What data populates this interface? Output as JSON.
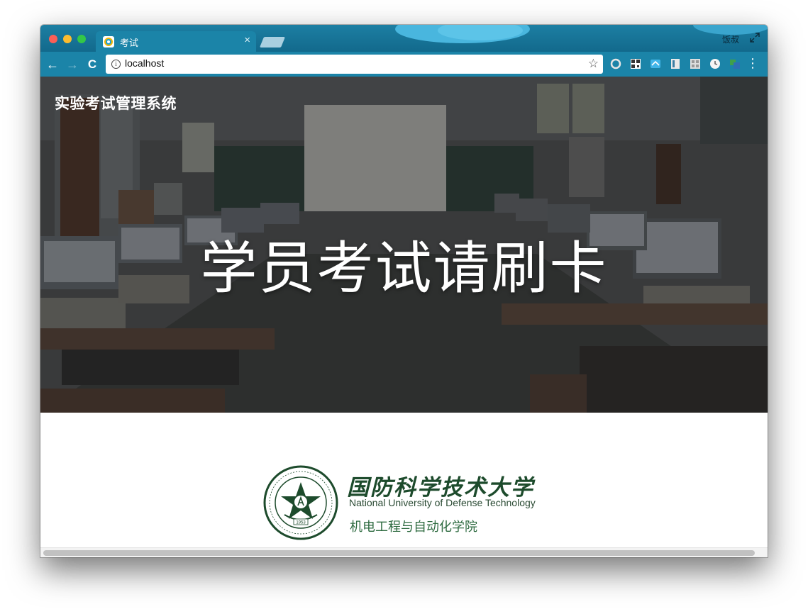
{
  "browser": {
    "tab": {
      "title": "考试",
      "close_label": "×"
    },
    "profile_name": "饭叔",
    "nav": {
      "back": "←",
      "forward": "→",
      "reload": "C"
    },
    "address_bar": {
      "url": "localhost",
      "info_label": "i",
      "bookmark_star": "☆"
    },
    "menu_label": "⋮",
    "extensions": [
      "circle-extension-icon",
      "qr-code-extension-icon",
      "blue-extension-icon",
      "reader-extension-icon",
      "grid-extension-icon",
      "clock-extension-icon",
      "green-s-extension-icon"
    ]
  },
  "page": {
    "site_title": "实验考试管理系统",
    "hero_text": "学员考试请刷卡",
    "footer": {
      "university_cn": "国防科学技术大学",
      "university_en": "National University of Defense Technology",
      "seal_year": "1953",
      "college": "机电工程与自动化学院"
    }
  },
  "colors": {
    "chrome_blue": "#1b84a8",
    "seal_green": "#1d4b2c",
    "college_green": "#2e6b40"
  }
}
